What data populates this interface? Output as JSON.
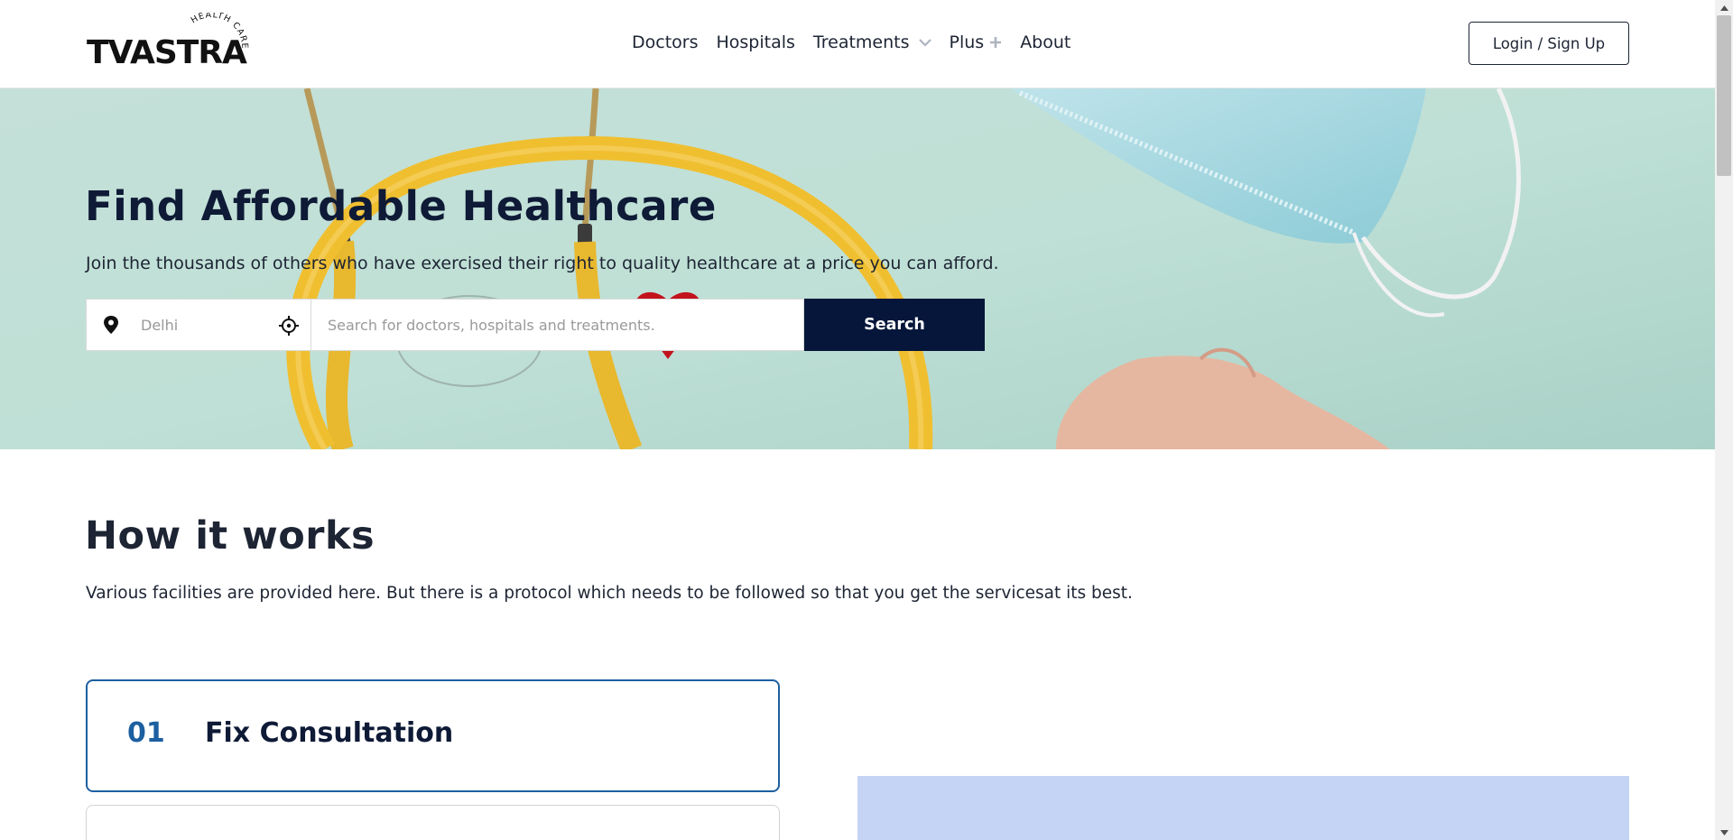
{
  "header": {
    "logo_text": "TVASTRA",
    "logo_tagline": "HEALTH CARE",
    "nav": [
      {
        "label": "Doctors"
      },
      {
        "label": "Hospitals"
      },
      {
        "label": "Treatments",
        "icon": "chevron-down-icon"
      },
      {
        "label": "Plus",
        "icon": "plus-icon"
      },
      {
        "label": "About"
      }
    ],
    "login_label": "Login / Sign Up"
  },
  "hero": {
    "title": "Find Affordable Healthcare",
    "subtitle": "Join the thousands of others who have exercised their right to quality healthcare at a price you can afford.",
    "location_placeholder": "Delhi",
    "search_placeholder": "Search for doctors, hospitals and treatments.",
    "search_label": "Search"
  },
  "how_it_works": {
    "title": "How it works",
    "subtitle": "Various facilities are provided here. But there is a protocol which needs to be followed so that you get the servicesat its best.",
    "steps": [
      {
        "number": "01",
        "title": "Fix Consultation"
      }
    ]
  },
  "colors": {
    "primary_dark": "#06163a",
    "accent_blue": "#1d5fa0",
    "panel_blue": "#c5d4f5"
  }
}
